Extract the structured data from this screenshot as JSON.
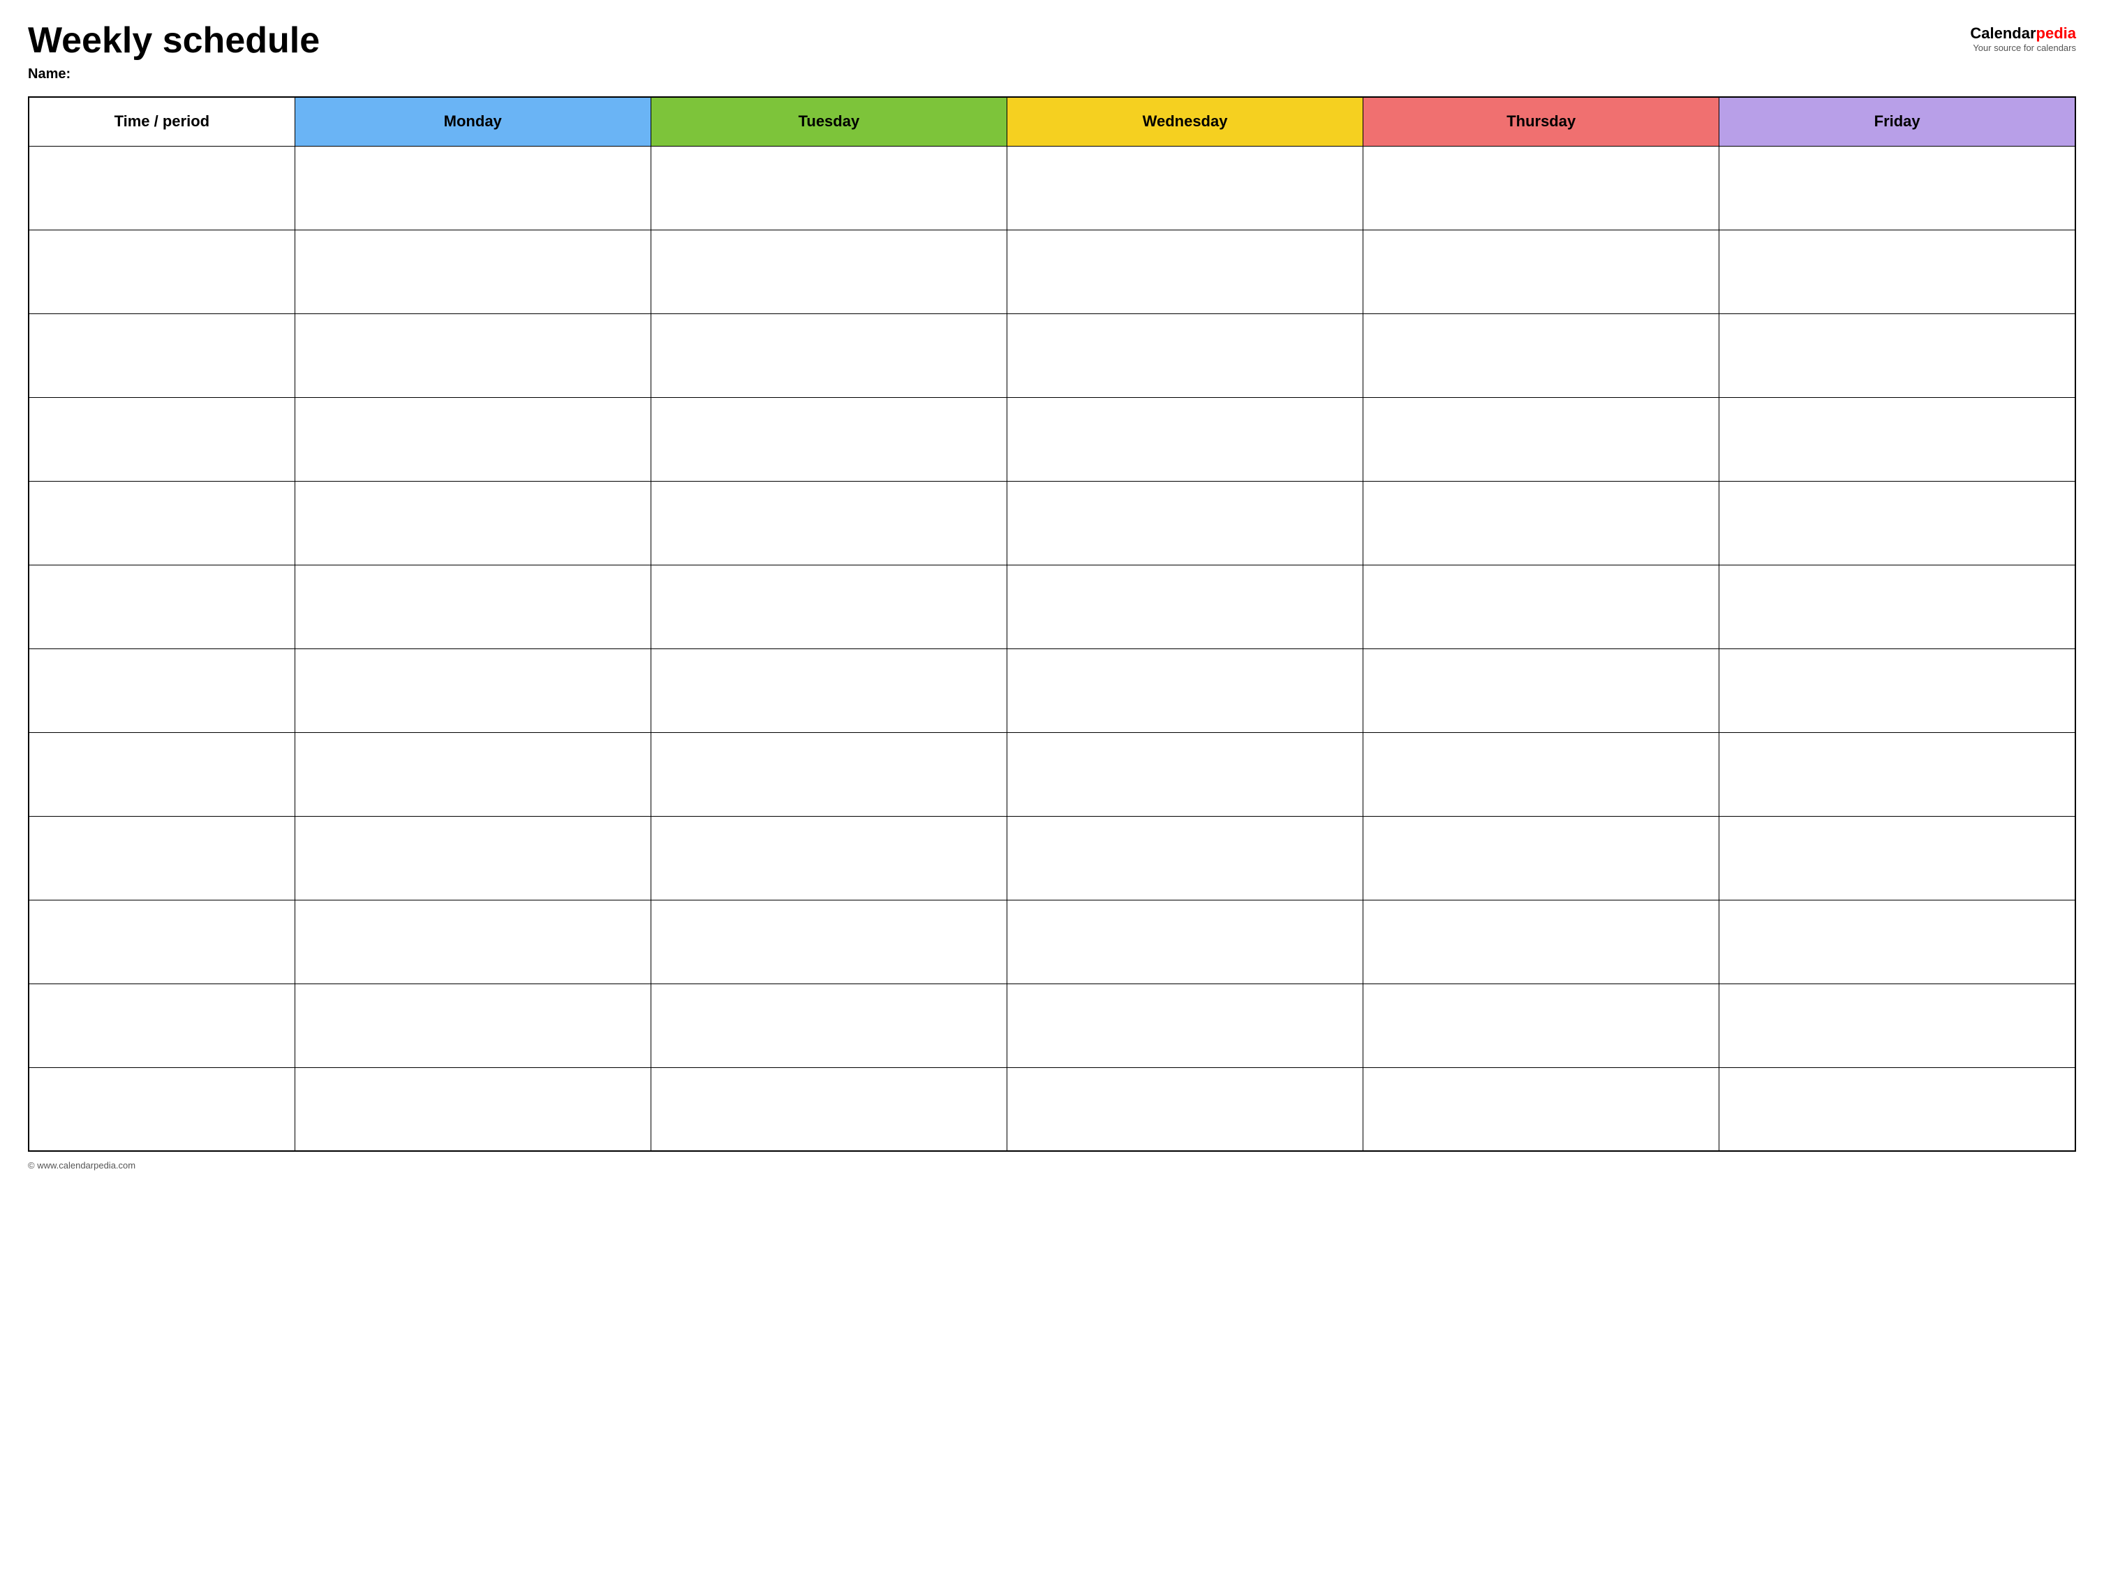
{
  "header": {
    "title": "Weekly schedule",
    "name_label": "Name:",
    "logo_calendar": "Calendar",
    "logo_pedia": "pedia",
    "logo_tagline": "Your source for calendars"
  },
  "table": {
    "columns": [
      {
        "label": "Time / period",
        "color": "none",
        "class": "col-time"
      },
      {
        "label": "Monday",
        "color": "#6ab4f5",
        "class": "col-mon"
      },
      {
        "label": "Tuesday",
        "color": "#7dc43a",
        "class": "col-tue"
      },
      {
        "label": "Wednesday",
        "color": "#f5d020",
        "class": "col-wed"
      },
      {
        "label": "Thursday",
        "color": "#f07070",
        "class": "col-thu"
      },
      {
        "label": "Friday",
        "color": "#b89fe8",
        "class": "col-fri"
      }
    ],
    "row_count": 12
  },
  "footer": {
    "url": "© www.calendarpedia.com"
  }
}
